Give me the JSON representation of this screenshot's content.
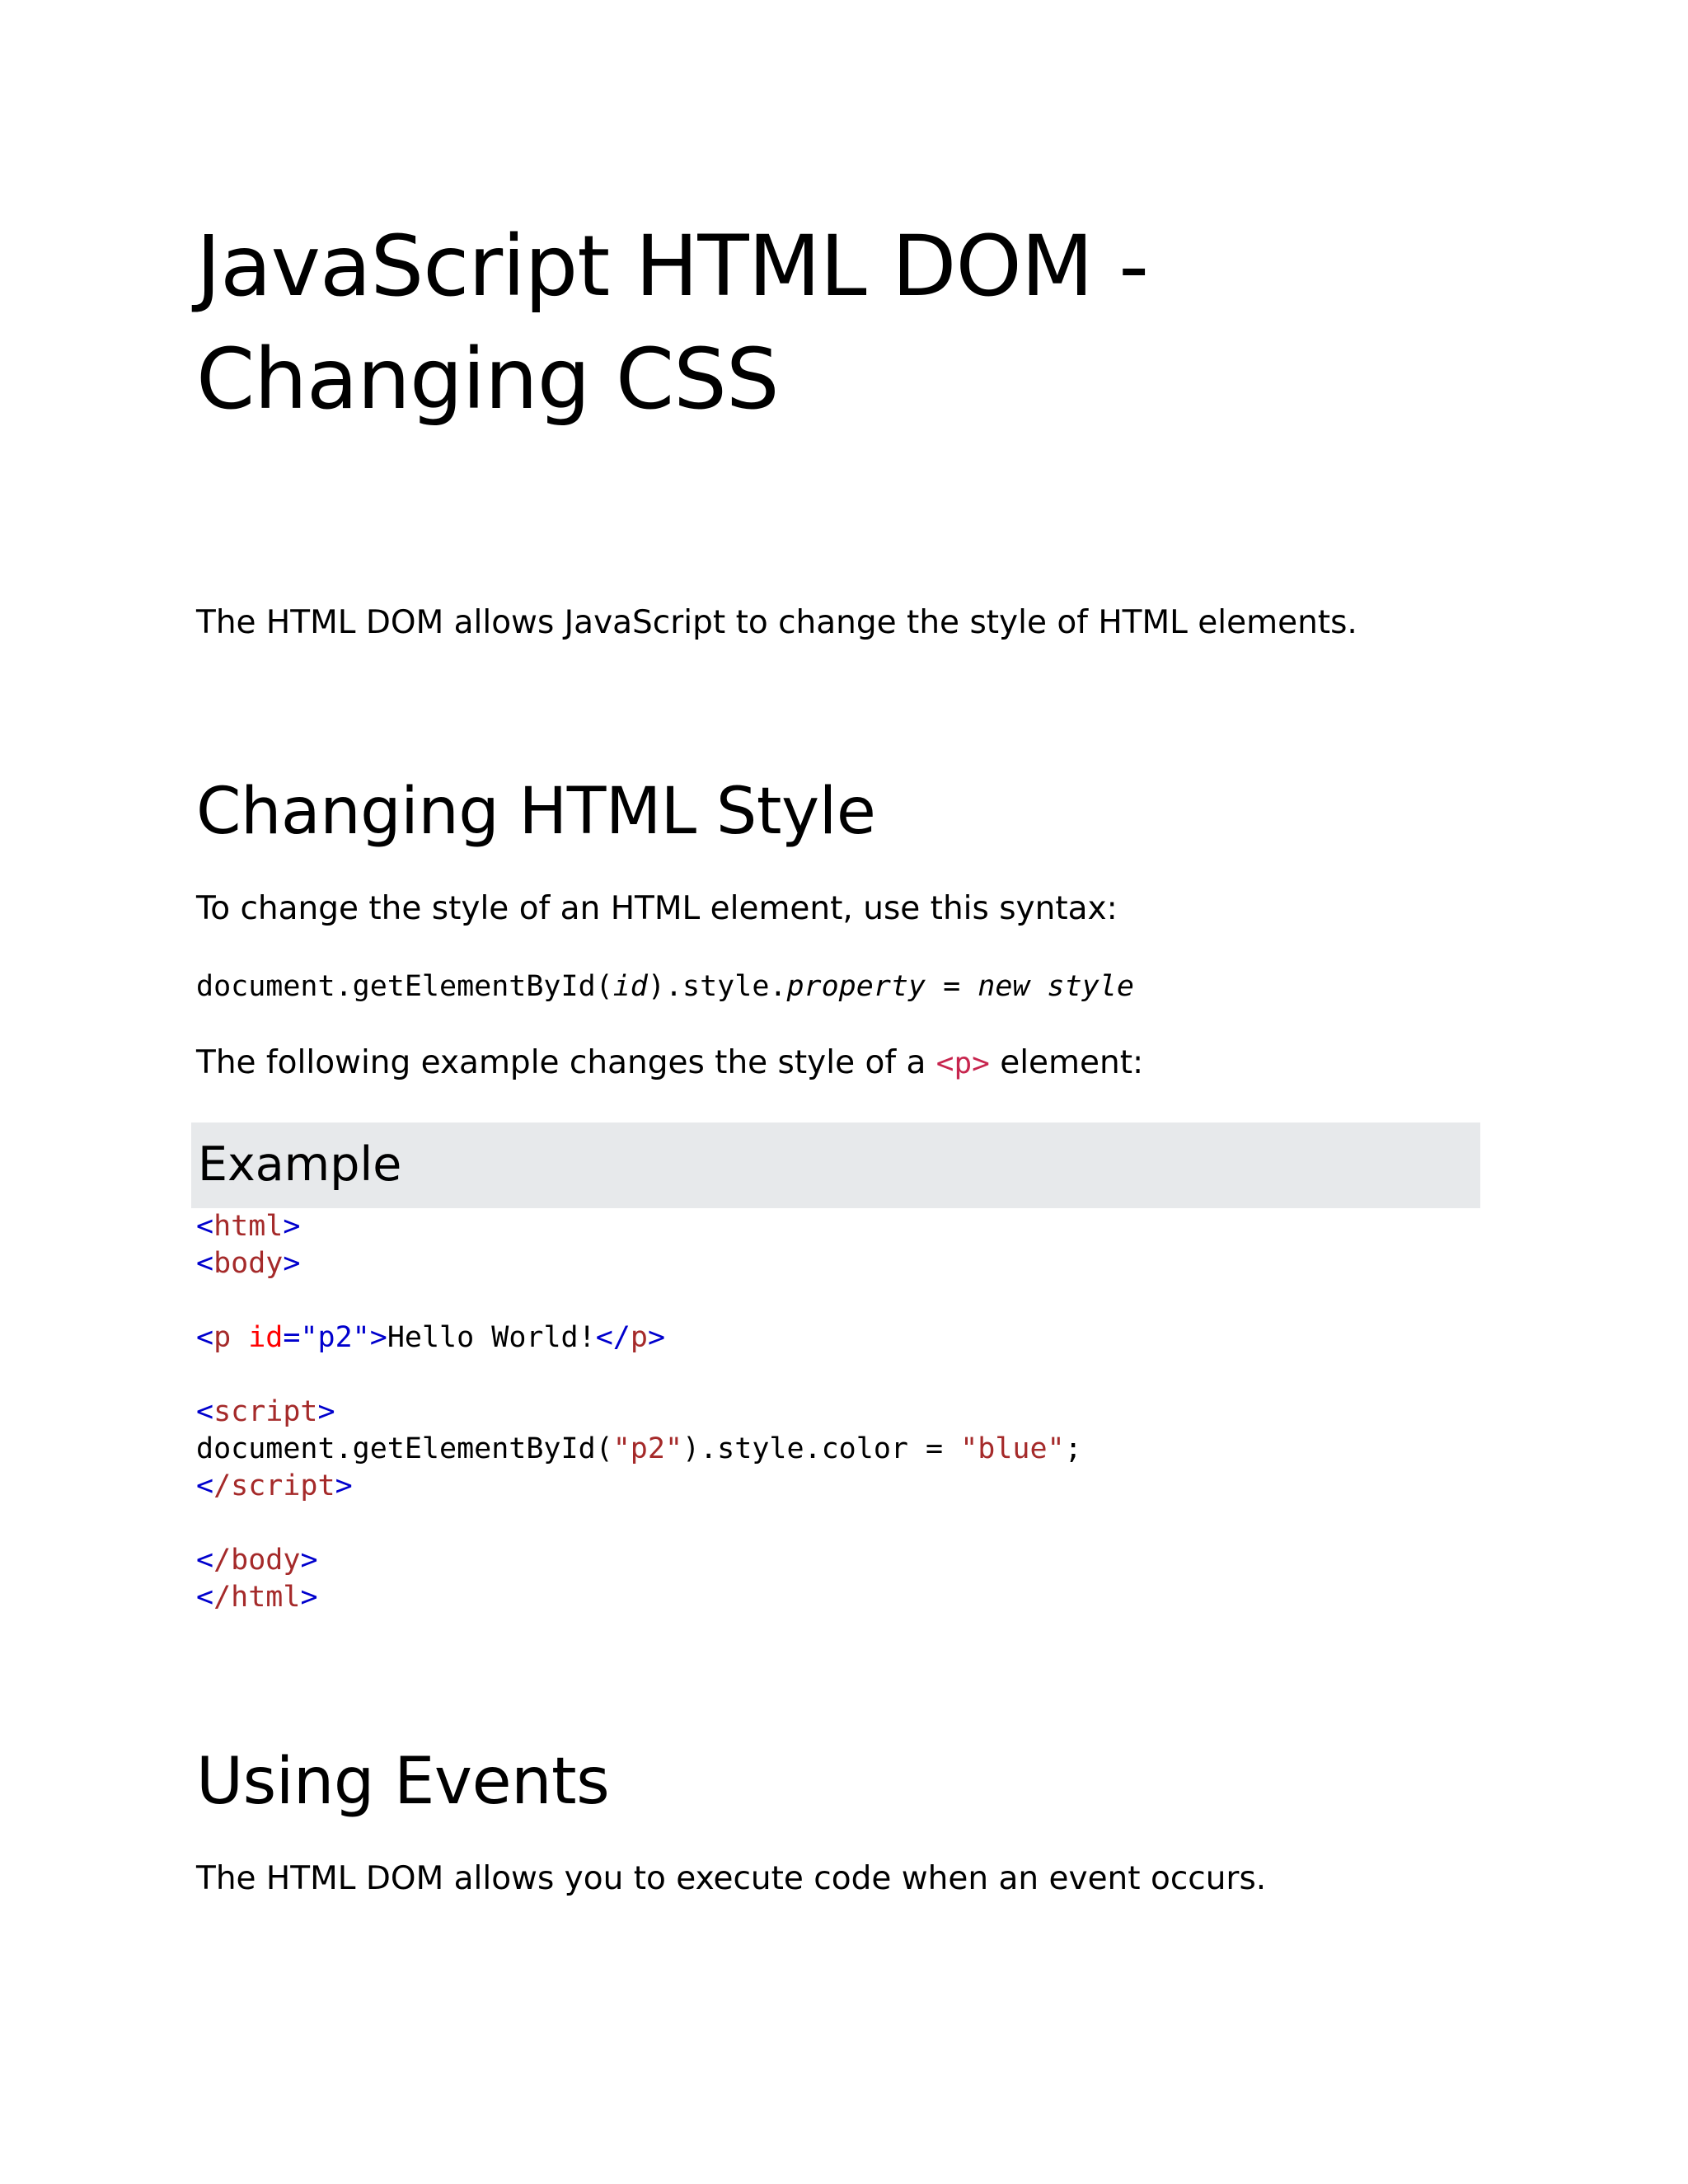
{
  "title": "JavaScript HTML DOM - Changing CSS",
  "intro": "The HTML DOM allows JavaScript to change the style of HTML elements.",
  "section_style": {
    "heading": "Changing HTML Style",
    "syntax_intro": "To change the style of an HTML element, use this syntax:",
    "syntax": {
      "part1": "document.getElementById(",
      "id": "id",
      "part2": ").style.",
      "property": "property",
      "equals": " = ",
      "value": "new style"
    },
    "example_intro": {
      "before": "The following example changes the style of a ",
      "code": "<p>",
      "after": " element:"
    },
    "example_label": "Example",
    "code": {
      "html_open": "html",
      "body_open": "body",
      "p_tag": "p",
      "p_attr": "id",
      "p_value": "\"p2\"",
      "p_text": "Hello World!",
      "script_open": "script",
      "js_call": "document.getElementById(",
      "js_arg": "\"p2\"",
      "js_prop": ").style.color = ",
      "js_value": "\"blue\"",
      "js_end": ";",
      "script_close": "/script",
      "body_close": "/body",
      "html_close": "/html"
    }
  },
  "section_events": {
    "heading": "Using Events",
    "intro": "The HTML DOM allows you to execute code when an event occurs."
  }
}
